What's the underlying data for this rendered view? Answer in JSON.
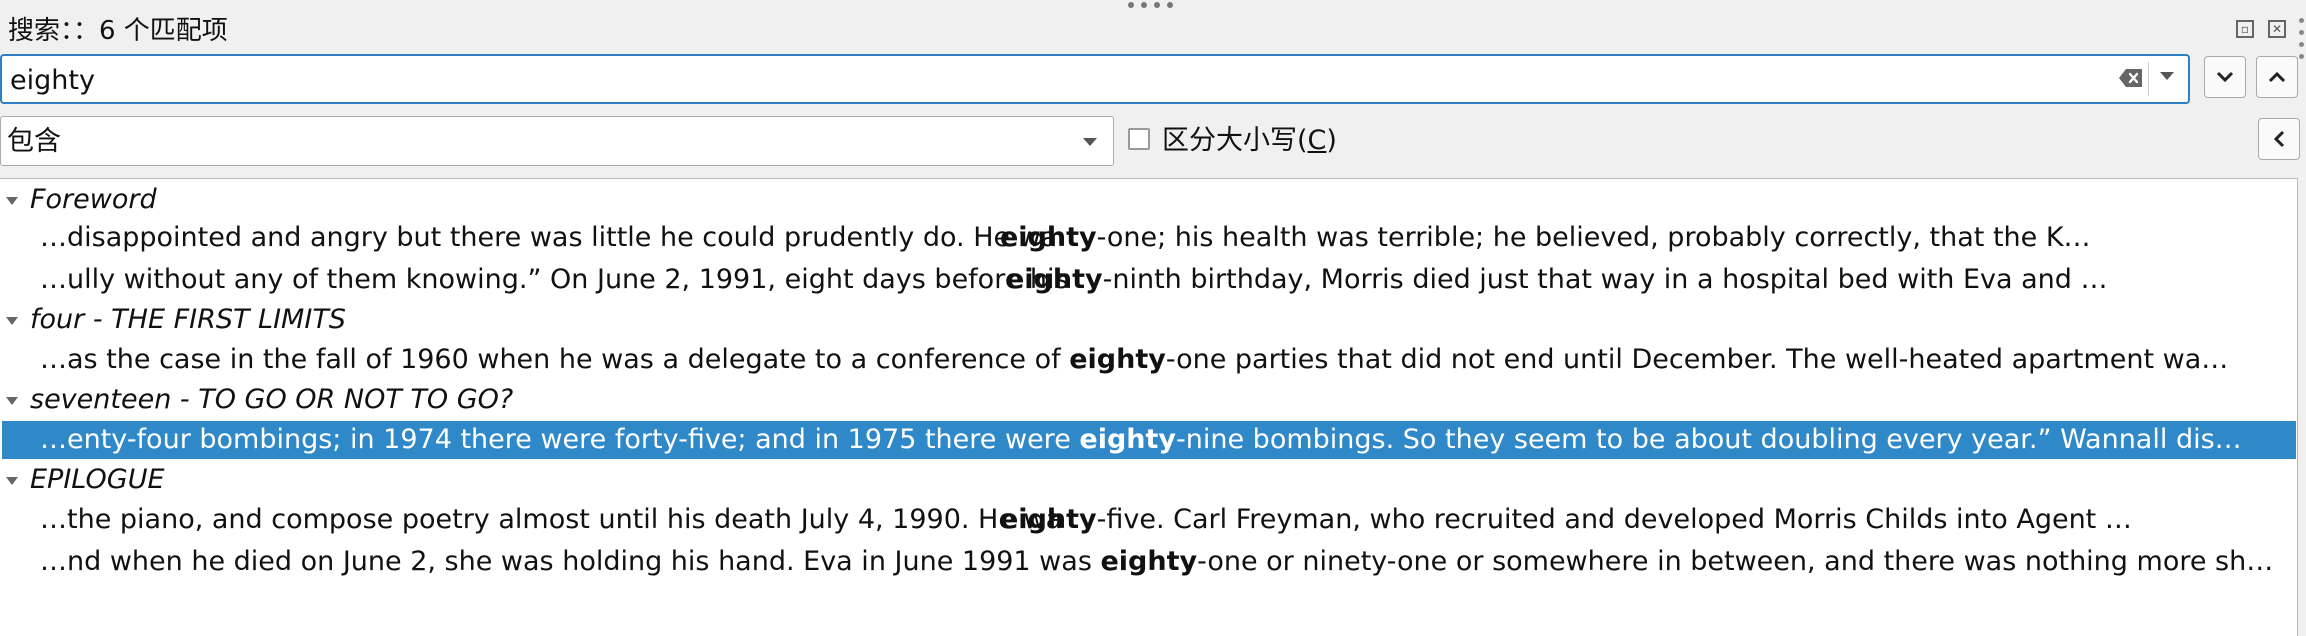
{
  "panel": {
    "title": "搜索：：6 个匹配项"
  },
  "search": {
    "value": "eighty"
  },
  "options": {
    "mode": "包含",
    "case_label_prefix": "区分大小写(",
    "case_label_key": "C",
    "case_label_suffix": ")",
    "case_checked": false
  },
  "results": [
    {
      "title": "Foreword",
      "matches": [
        {
          "before": "…disappointed and angry but there was little he could prudently do. He wa",
          "term": "eighty",
          "after": "-one; his health was terrible; he believed, probably correctly, that the K…"
        },
        {
          "before": "…ully without any of them knowing.”   On June 2, 1991, eight days before his",
          "term": "eighty",
          "after": "-ninth birthday, Morris died just that way in a hospital bed with Eva and …"
        }
      ]
    },
    {
      "title": "four - THE FIRST LIMITS",
      "matches": [
        {
          "before": "…as the case in the fall of 1960 when he was a delegate to a conference of ",
          "term": "eighty",
          "after": "-one parties that did not end until December. The well-heated apartment wa…"
        }
      ]
    },
    {
      "title": "seventeen - TO GO OR NOT TO GO?",
      "matches": [
        {
          "before": "…enty-four bombings; in 1974 there were forty-five; and in 1975 there were ",
          "term": "eighty",
          "after": "-nine bombings. So they seem to be about doubling every year.”   Wannall dis…",
          "selected": true
        }
      ]
    },
    {
      "title": "EPILOGUE",
      "matches": [
        {
          "before": "…the piano, and compose poetry almost until his death July 4, 1990. He wa ",
          "term": "eighty",
          "after": "-five. Carl Freyman, who recruited and developed Morris Childs into Agent …"
        },
        {
          "before": "…nd when he died on June 2, she was holding his hand. Eva in June 1991 was ",
          "term": "eighty",
          "after": "-one or ninety-one or somewhere in between, and there was nothing more sh…"
        }
      ]
    }
  ]
}
